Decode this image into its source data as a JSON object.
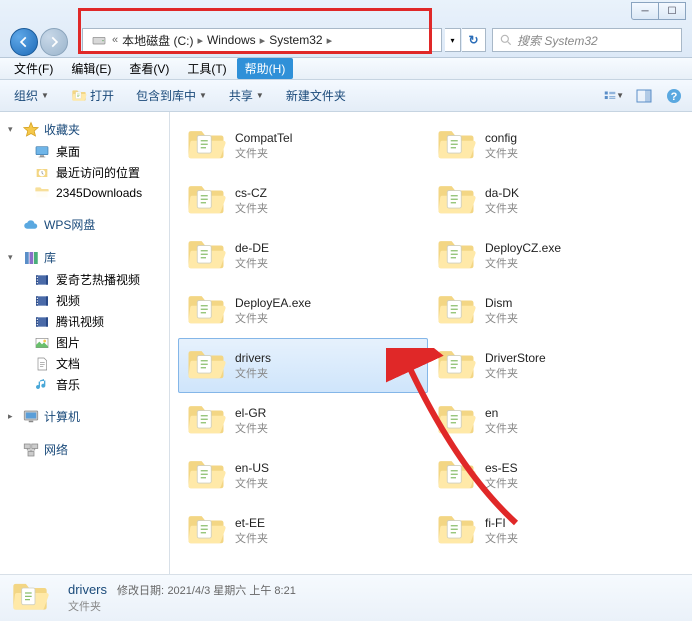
{
  "breadcrumb": {
    "prefix": "«",
    "items": [
      "本地磁盘 (C:)",
      "Windows",
      "System32"
    ]
  },
  "search": {
    "placeholder": "搜索 System32"
  },
  "menubar": {
    "file": "文件(F)",
    "edit": "编辑(E)",
    "view": "查看(V)",
    "tools": "工具(T)",
    "help": "帮助(H)"
  },
  "toolbar": {
    "organize": "组织",
    "open": "打开",
    "include": "包含到库中",
    "share": "共享",
    "newfolder": "新建文件夹"
  },
  "sidebar": {
    "favorites": {
      "label": "收藏夹",
      "items": [
        {
          "icon": "desktop",
          "label": "桌面"
        },
        {
          "icon": "recent",
          "label": "最近访问的位置"
        },
        {
          "icon": "folder",
          "label": "2345Downloads"
        }
      ]
    },
    "wps": {
      "label": "WPS网盘"
    },
    "libraries": {
      "label": "库",
      "items": [
        {
          "icon": "video-lib",
          "label": "爱奇艺热播视频"
        },
        {
          "icon": "video",
          "label": "视频"
        },
        {
          "icon": "tencent",
          "label": "腾讯视频"
        },
        {
          "icon": "pictures",
          "label": "图片"
        },
        {
          "icon": "documents",
          "label": "文档"
        },
        {
          "icon": "music",
          "label": "音乐"
        }
      ]
    },
    "computer": {
      "label": "计算机"
    },
    "network": {
      "label": "网络"
    }
  },
  "content": {
    "type_folder": "文件夹",
    "left": [
      {
        "name": "CompatTel",
        "type": "文件夹"
      },
      {
        "name": "cs-CZ",
        "type": "文件夹"
      },
      {
        "name": "de-DE",
        "type": "文件夹"
      },
      {
        "name": "DeployEA.exe",
        "type": "文件夹"
      },
      {
        "name": "drivers",
        "type": "文件夹",
        "selected": true
      },
      {
        "name": "el-GR",
        "type": "文件夹"
      },
      {
        "name": "en-US",
        "type": "文件夹"
      },
      {
        "name": "et-EE",
        "type": "文件夹"
      }
    ],
    "right": [
      {
        "name": "config",
        "type": "文件夹"
      },
      {
        "name": "da-DK",
        "type": "文件夹"
      },
      {
        "name": "DeployCZ.exe",
        "type": "文件夹"
      },
      {
        "name": "Dism",
        "type": "文件夹"
      },
      {
        "name": "DriverStore",
        "type": "文件夹"
      },
      {
        "name": "en",
        "type": "文件夹"
      },
      {
        "name": "es-ES",
        "type": "文件夹"
      },
      {
        "name": "fi-FI",
        "type": "文件夹"
      }
    ]
  },
  "details": {
    "name": "drivers",
    "meta_label": "修改日期:",
    "meta_value": "2021/4/3 星期六 上午 8:21",
    "type": "文件夹"
  }
}
